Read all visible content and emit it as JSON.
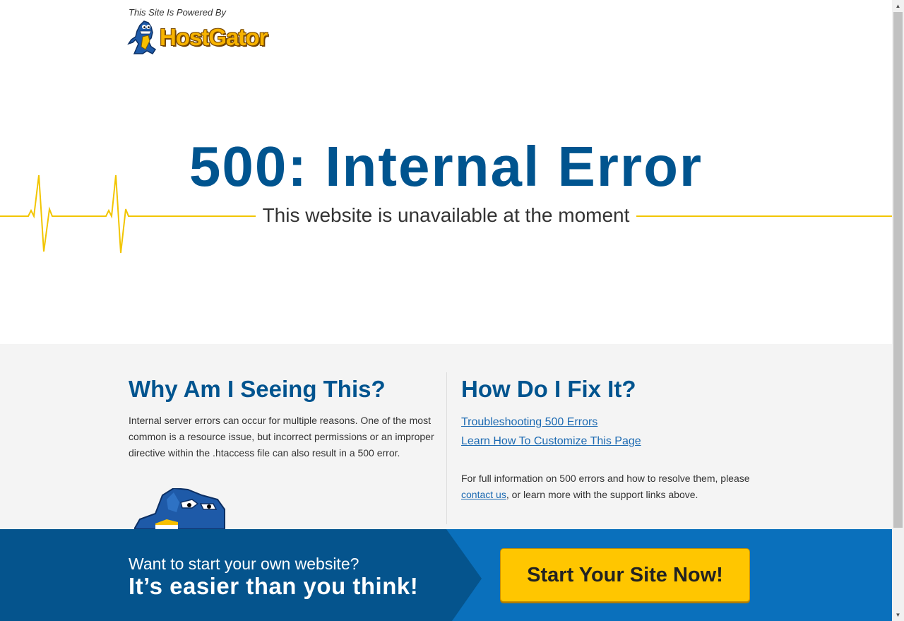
{
  "header": {
    "powered_by": "This Site Is Powered By",
    "logo_text": "HostGator"
  },
  "hero": {
    "title": "500: Internal Error",
    "subtitle": "This website is unavailable at the moment"
  },
  "why": {
    "title": "Why Am I Seeing This?",
    "body": "Internal server errors can occur for multiple reasons. One of the most common is a resource issue, but incorrect permissions or an improper directive within the .htaccess file can also result in a 500 error."
  },
  "fix": {
    "title": "How Do I Fix It?",
    "links": [
      "Troubleshooting 500 Errors",
      "Learn How To Customize This Page"
    ],
    "info_before": "For full information on 500 errors and how to resolve them, please ",
    "contact_link": "contact us",
    "info_after": ", or learn more with the support links above."
  },
  "cta": {
    "line1": "Want to start your own website?",
    "line2": "It’s easier than you think!",
    "button": "Start Your Site Now!"
  },
  "colors": {
    "brand_blue": "#00548f",
    "cta_blue": "#0a70bc",
    "cta_dark_blue": "#05548d",
    "accent_yellow": "#ffc600",
    "pulse_yellow": "#f2c500"
  },
  "icons": [
    "gator-mascot-icon",
    "heartbeat-line",
    "scroll-up-arrow-icon",
    "scroll-down-arrow-icon"
  ]
}
